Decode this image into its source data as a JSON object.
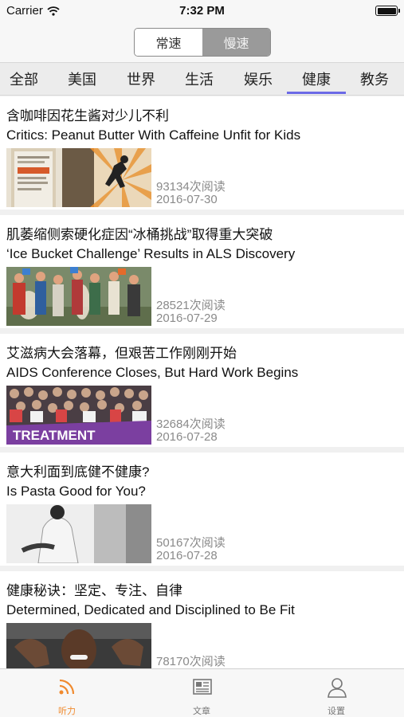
{
  "status_bar": {
    "carrier": "Carrier",
    "time": "7:32 PM"
  },
  "speed_toggle": {
    "normal": "常速",
    "slow": "慢速",
    "selected": "常速"
  },
  "categories": [
    "全部",
    "美国",
    "世界",
    "生活",
    "娱乐",
    "健康",
    "教务"
  ],
  "active_category": "健康",
  "articles": [
    {
      "title_zh": "含咖啡因花生酱对少儿不利",
      "title_en": "Critics: Peanut Butter With Caffeine Unfit for Kids",
      "reads": "93134次阅读",
      "date": "2016-07-30"
    },
    {
      "title_zh": "肌萎缩侧索硬化症因“冰桶挑战”取得重大突破",
      "title_en": "‘Ice Bucket Challenge’ Results in ALS Discovery",
      "reads": "28521次阅读",
      "date": "2016-07-29"
    },
    {
      "title_zh": "艾滋病大会落幕，但艰苦工作刚刚开始",
      "title_en": "AIDS Conference Closes, But Hard Work Begins",
      "reads": "32684次阅读",
      "date": "2016-07-28",
      "image_text": "TREATMENT"
    },
    {
      "title_zh": "意大利面到底健不健康?",
      "title_en": "Is Pasta Good for You?",
      "reads": "50167次阅读",
      "date": "2016-07-28"
    },
    {
      "title_zh": "健康秘诀：坚定、专注、自律",
      "title_en": "Determined, Dedicated and Disciplined to Be Fit",
      "reads": "78170次阅读",
      "date": ""
    }
  ],
  "tabbar": [
    {
      "label": "听力",
      "icon": "rss-icon",
      "active": true
    },
    {
      "label": "文章",
      "icon": "newspaper-icon",
      "active": false
    },
    {
      "label": "设置",
      "icon": "person-icon",
      "active": false
    }
  ],
  "colors": {
    "accent": "#f08a2e",
    "tab_underline": "#6c6ae6"
  }
}
